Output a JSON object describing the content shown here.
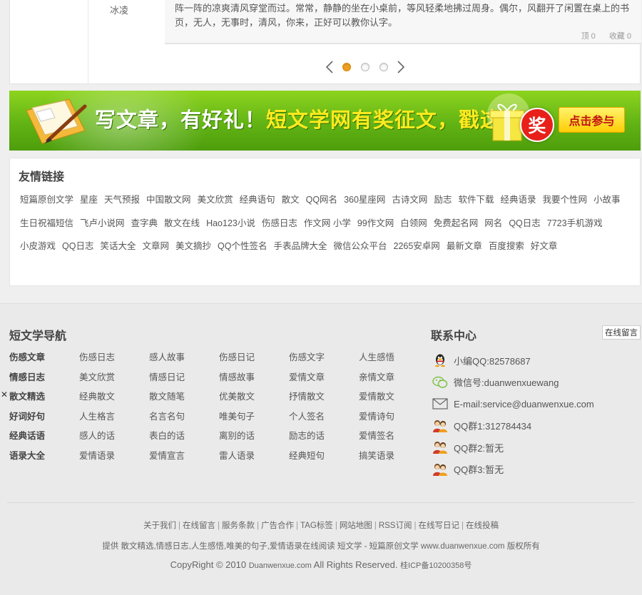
{
  "comment": {
    "user": "冰凌",
    "text": "阵一阵的凉爽清风穿堂而过。常常，静静的坐在小桌前，等风轻柔地拂过周身。偶尔，风翻开了闲置在桌上的书页，无人，无事时，清风，你来，正好可以教你认字。",
    "likes_label": "顶 0",
    "favorites_label": "收藏 0"
  },
  "pager": {
    "prev": "〈",
    "next": "〉",
    "pages": 3,
    "current": 1
  },
  "banner": {
    "slogan_main": "写文章，有好礼！",
    "slogan_highlight": "短文学网有奖征文，戳这里",
    "prize": "奖",
    "join_label": "点击参与"
  },
  "friend_links": {
    "title": "友情链接",
    "items": [
      "短篇原创文学",
      "星座",
      "天气预报",
      "中国散文网",
      "美文欣赏",
      "经典语句",
      "散文",
      "QQ网名",
      "360星座网",
      "古诗文网",
      "励志",
      "软件下载",
      "经典语录",
      "我要个性网",
      "小故事",
      "生日祝福短信",
      "飞卢小说网",
      "查字典",
      "散文在线",
      "Hao123小说",
      "伤感日志",
      "作文网 小学",
      "99作文网",
      "白领网",
      "免费起名网",
      "网名",
      "QQ日志",
      "7723手机游戏",
      "小皮游戏",
      "QQ日志",
      "笑话大全",
      "文章网",
      "美文摘抄",
      "QQ个性签名",
      "手表品牌大全",
      "微信公众平台",
      "2265安卓网",
      "最新文章",
      "百度搜索",
      "好文章"
    ]
  },
  "nav": {
    "title": "短文学导航",
    "rows": [
      [
        "伤感文章",
        "伤感日志",
        "感人故事",
        "伤感日记",
        "伤感文字",
        "人生感悟"
      ],
      [
        "情感日志",
        "美文欣赏",
        "情感日记",
        "情感故事",
        "爱情文章",
        "亲情文章"
      ],
      [
        "散文精选",
        "经典散文",
        "散文随笔",
        "优美散文",
        "抒情散文",
        "爱情散文"
      ],
      [
        "好词好句",
        "人生格言",
        "名言名句",
        "唯美句子",
        "个人签名",
        "爱情诗句"
      ],
      [
        "经典话语",
        "感人的话",
        "表白的话",
        "离别的话",
        "励志的话",
        "爱情签名"
      ],
      [
        "语录大全",
        "爱情语录",
        "爱情宣言",
        "雷人语录",
        "经典短句",
        "搞笑语录"
      ]
    ]
  },
  "contact": {
    "title": "联系中心",
    "online_message": "在线留言",
    "items": [
      {
        "icon": "qq-penguin-icon",
        "text": "小编QQ:82578687"
      },
      {
        "icon": "wechat-icon",
        "text": "微信号:duanwenxuewang"
      },
      {
        "icon": "mail-icon",
        "text": "E-mail:service@duanwenxue.com"
      },
      {
        "icon": "qq-group-icon",
        "text": "QQ群1:312784434"
      },
      {
        "icon": "qq-group-icon",
        "text": "QQ群2:暂无"
      },
      {
        "icon": "qq-group-icon",
        "text": "QQ群3:暂无"
      }
    ]
  },
  "side_mark": "✕",
  "bottom_links": [
    "关于我们",
    "在线留言",
    "服务条款",
    "广告合作",
    "TAG标签",
    "网站地图",
    "RSS订阅",
    "在线写日记",
    "在线投稿"
  ],
  "provide_text": "提供 散文精选,情感日志,人生感悟,唯美的句子,爱情语录在线阅读 短文学 - 短篇原创文学 www.duanwenxue.com 版权所有",
  "copyright": {
    "main": "CopyRight © 2010",
    "domain": "Duanwenxue.com",
    "rights": "All Rights Reserved.",
    "icp": "桂ICP备10200358号"
  },
  "colors": {
    "banner_green": "#62b314",
    "banner_highlight": "#ffea1f",
    "pager_active": "#f0a020",
    "prize_red": "#e8201a"
  }
}
